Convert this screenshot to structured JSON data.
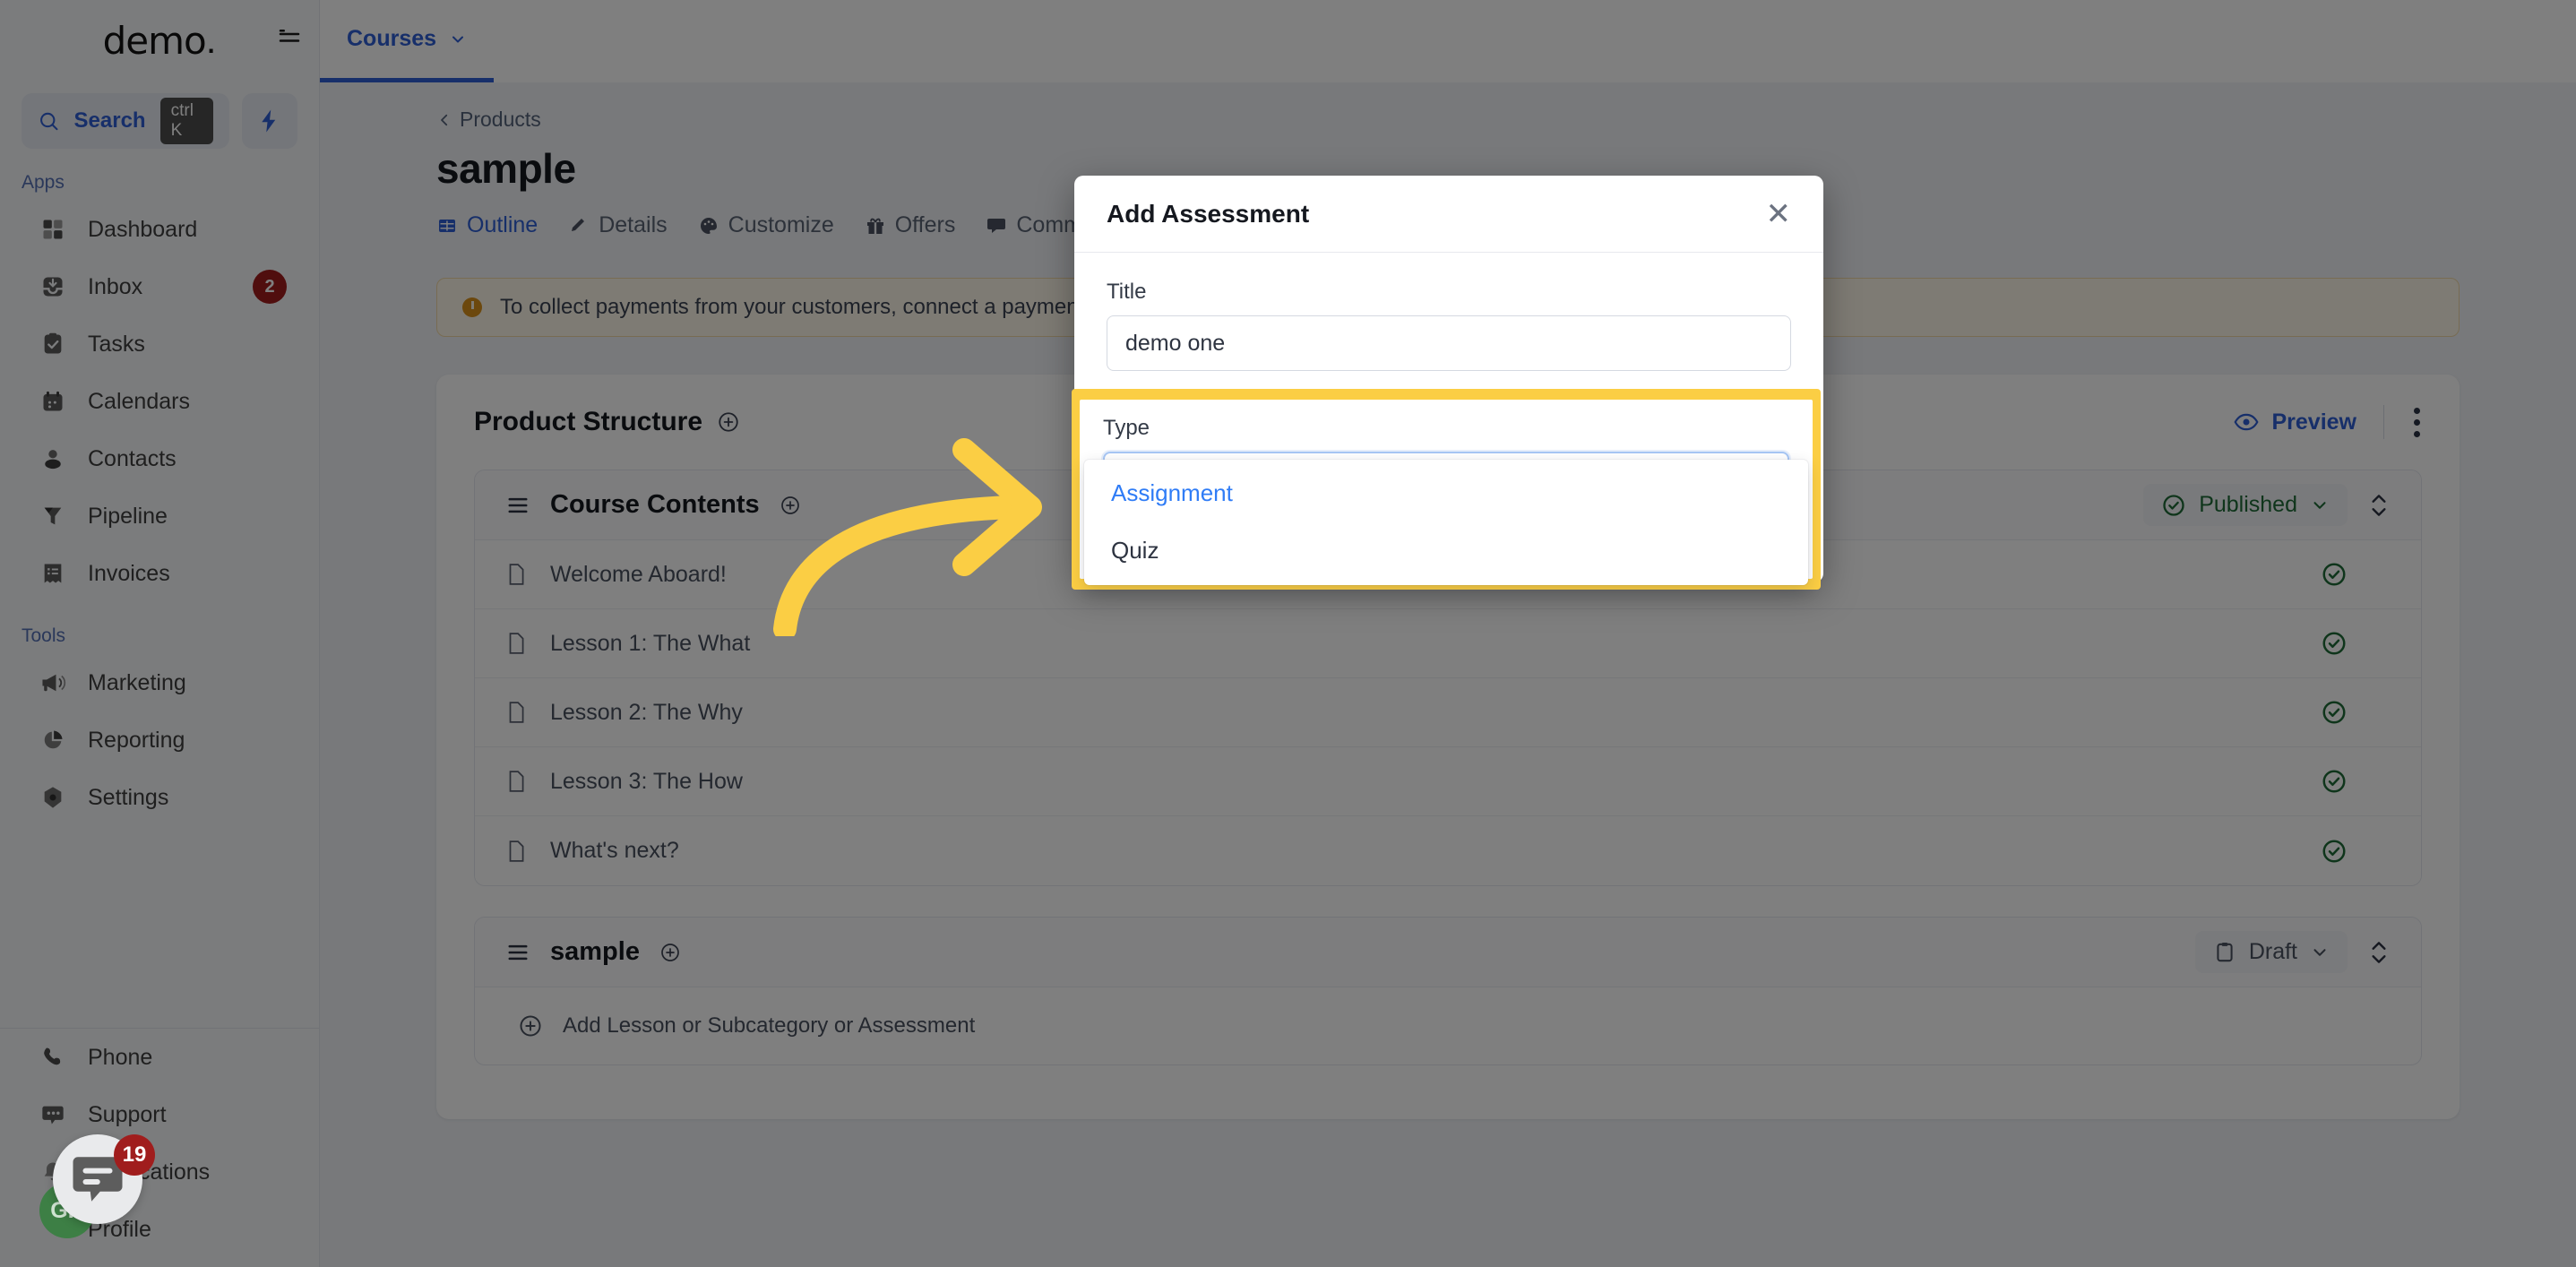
{
  "sidebar": {
    "brand": "demo",
    "brand_dot": ".",
    "search": {
      "label": "Search",
      "shortcut": "ctrl K"
    },
    "sections": [
      {
        "label": "Apps",
        "items": [
          {
            "label": "Dashboard",
            "icon": "grid-icon",
            "badge": ""
          },
          {
            "label": "Inbox",
            "icon": "inbox-icon",
            "badge": "2"
          },
          {
            "label": "Tasks",
            "icon": "clipboard-check-icon",
            "badge": ""
          },
          {
            "label": "Calendars",
            "icon": "calendar-icon",
            "badge": ""
          },
          {
            "label": "Contacts",
            "icon": "person-icon",
            "badge": ""
          },
          {
            "label": "Pipeline",
            "icon": "funnel-icon",
            "badge": ""
          },
          {
            "label": "Invoices",
            "icon": "receipt-icon",
            "badge": ""
          }
        ]
      },
      {
        "label": "Tools",
        "items": [
          {
            "label": "Marketing",
            "icon": "megaphone-icon",
            "badge": ""
          },
          {
            "label": "Reporting",
            "icon": "pie-chart-icon",
            "badge": ""
          },
          {
            "label": "Settings",
            "icon": "gear-icon",
            "badge": ""
          }
        ]
      }
    ],
    "bottom_items": [
      {
        "label": "Phone",
        "icon": "phone-icon",
        "badge": ""
      },
      {
        "label": "Support",
        "icon": "chat-dots-icon",
        "badge": ""
      },
      {
        "label": "Notifications",
        "icon": "bell-icon",
        "badge": "19"
      },
      {
        "label": "Profile",
        "icon": "avatar-icon",
        "badge": ""
      }
    ]
  },
  "topbar": {
    "tab": "Courses"
  },
  "page": {
    "breadcrumb": "Products",
    "title": "sample",
    "tabs": [
      {
        "label": "Outline",
        "icon": "table-icon",
        "active": true
      },
      {
        "label": "Details",
        "icon": "pencil-icon",
        "active": false
      },
      {
        "label": "Customize",
        "icon": "palette-icon",
        "active": false
      },
      {
        "label": "Offers",
        "icon": "gift-icon",
        "active": false
      },
      {
        "label": "Comments",
        "icon": "comment-icon",
        "active": false
      }
    ],
    "warning": "To collect payments from your customers, connect a payment p",
    "structure_title": "Product Structure",
    "preview_label": "Preview",
    "groups": [
      {
        "name": "Course Contents",
        "status": "Published",
        "status_icon": "check-circle-icon",
        "rows": [
          {
            "label": "Welcome Aboard!",
            "status_icon": "check-circle-icon"
          },
          {
            "label": "Lesson 1: The What",
            "status_icon": "check-circle-icon"
          },
          {
            "label": "Lesson 2: The Why",
            "status_icon": "check-circle-icon"
          },
          {
            "label": "Lesson 3: The How",
            "status_icon": "check-circle-icon"
          },
          {
            "label": "What's next?",
            "status_icon": "check-circle-icon"
          }
        ]
      },
      {
        "name": "sample",
        "status": "Draft",
        "status_icon": "clipboard-icon",
        "add_row": "Add Lesson or Subcategory or Assessment",
        "rows": []
      }
    ]
  },
  "modal": {
    "title": "Add Assessment",
    "close_icon": "close-icon",
    "title_field": {
      "label": "Title",
      "value": "demo one",
      "placeholder": "Title"
    },
    "type_field": {
      "label": "Type",
      "value": "Assignment",
      "chevron": "chevron-up-icon",
      "options": [
        {
          "label": "Assignment",
          "selected": true
        },
        {
          "label": "Quiz",
          "selected": false
        }
      ]
    }
  },
  "chat": {
    "badge": "19",
    "avatar_initials": "GR"
  },
  "colors": {
    "accent_blue": "#2f5fd4",
    "highlight_yellow": "#FBCE44",
    "published_green": "#1e6b37",
    "badge_red": "#a01d1d",
    "warning_amber": "#d9901a"
  }
}
